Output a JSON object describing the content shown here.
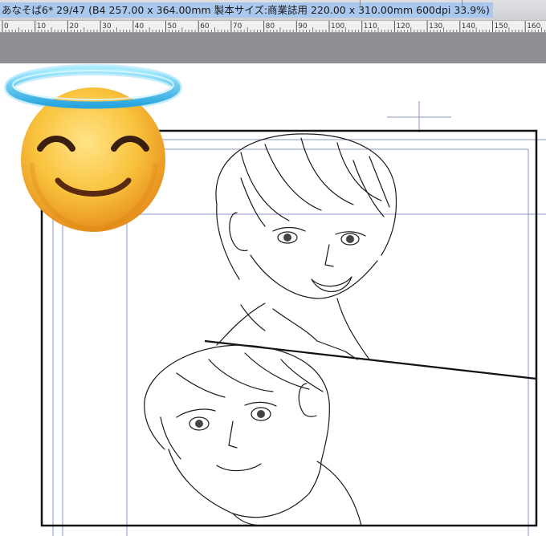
{
  "window": {
    "title": "あなそば6* 29/47 (B4 257.00 x 364.00mm 製本サイズ:商業誌用 220.00 x 310.00mm 600dpi 33.9%)"
  },
  "ruler": {
    "labels": [
      "0",
      "10",
      "20",
      "30",
      "40",
      "50",
      "60",
      "70",
      "80",
      "90",
      "100",
      "110",
      "120",
      "130",
      "140",
      "150",
      "160"
    ]
  },
  "colors": {
    "title_highlight": "#aac8ee",
    "toolstrip": "#8d8f93",
    "guide_blue": "#8a93c8",
    "halo": "#4fc8f4",
    "emoji_face": "#f9c33d"
  },
  "overlay": {
    "icon": "smiling-face-with-halo-emoji"
  }
}
